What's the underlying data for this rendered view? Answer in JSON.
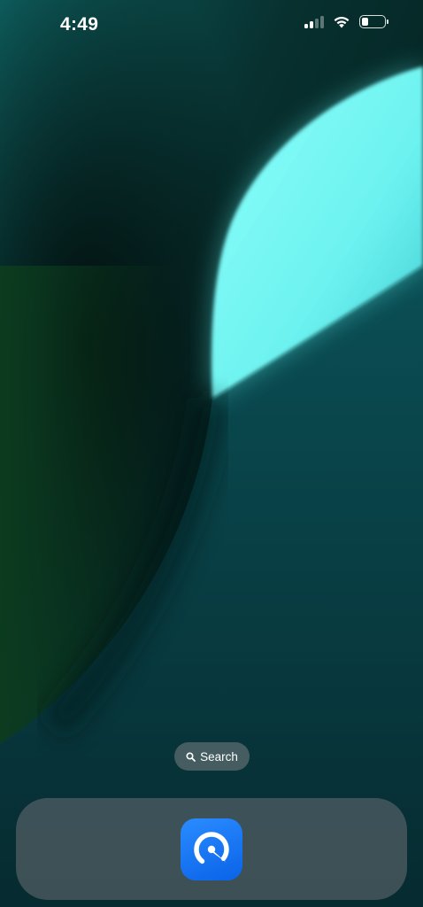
{
  "status_bar": {
    "time": "4:49",
    "signal_bars_active": 2,
    "signal_bars_total": 4,
    "battery_level": 0.3
  },
  "search": {
    "label": "Search",
    "icon": "magnifier-icon"
  },
  "dock": {
    "apps": [
      {
        "icon": "speedometer-app-icon",
        "accent": "#1877f2"
      }
    ]
  },
  "colors": {
    "wallpaper_highlight": "#7ffcf8",
    "wallpaper_dark": "#041b1d",
    "app_icon": "#1877f2"
  }
}
